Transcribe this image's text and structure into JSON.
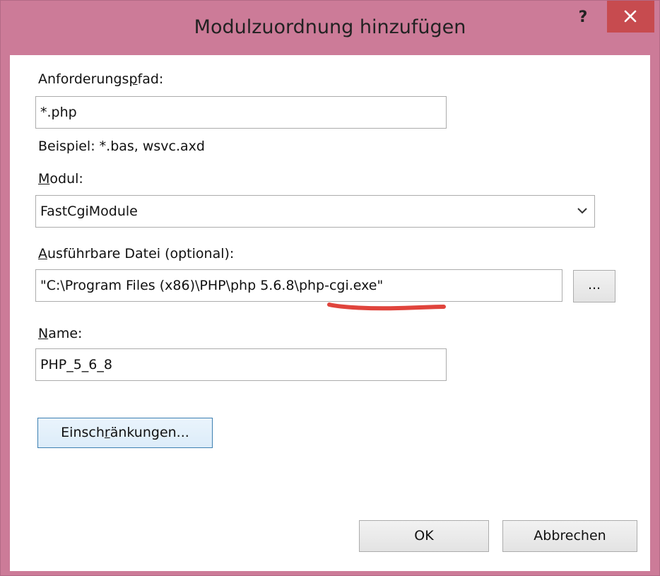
{
  "window": {
    "title": "Modulzuordnung hinzufügen",
    "help_label": "?",
    "close_icon": "close-icon",
    "titlebar_color": "#cc7b98",
    "close_color": "#c74b4f"
  },
  "request_path": {
    "label_pre": "Anforderungs",
    "label_ul": "p",
    "label_post": "fad:",
    "value": "*.php",
    "example": "Beispiel: *.bas, wsvc.axd"
  },
  "module": {
    "label_ul": "M",
    "label_post": "odul:",
    "value": "FastCgiModule",
    "dropdown_icon": "chevron-down-icon"
  },
  "executable": {
    "label_ul": "A",
    "label_post": "usführbare Datei (optional):",
    "value": "\"C:\\Program Files (x86)\\PHP\\php 5.6.8\\php-cgi.exe\"",
    "browse_label": "...",
    "annotation_color": "#e0443c"
  },
  "name": {
    "label_ul": "N",
    "label_post": "ame:",
    "value": "PHP_5_6_8"
  },
  "restrictions": {
    "label_pre": "Einsch",
    "label_ul": "r",
    "label_post": "änkungen..."
  },
  "footer": {
    "ok_label": "OK",
    "cancel_label": "Abbrechen"
  }
}
